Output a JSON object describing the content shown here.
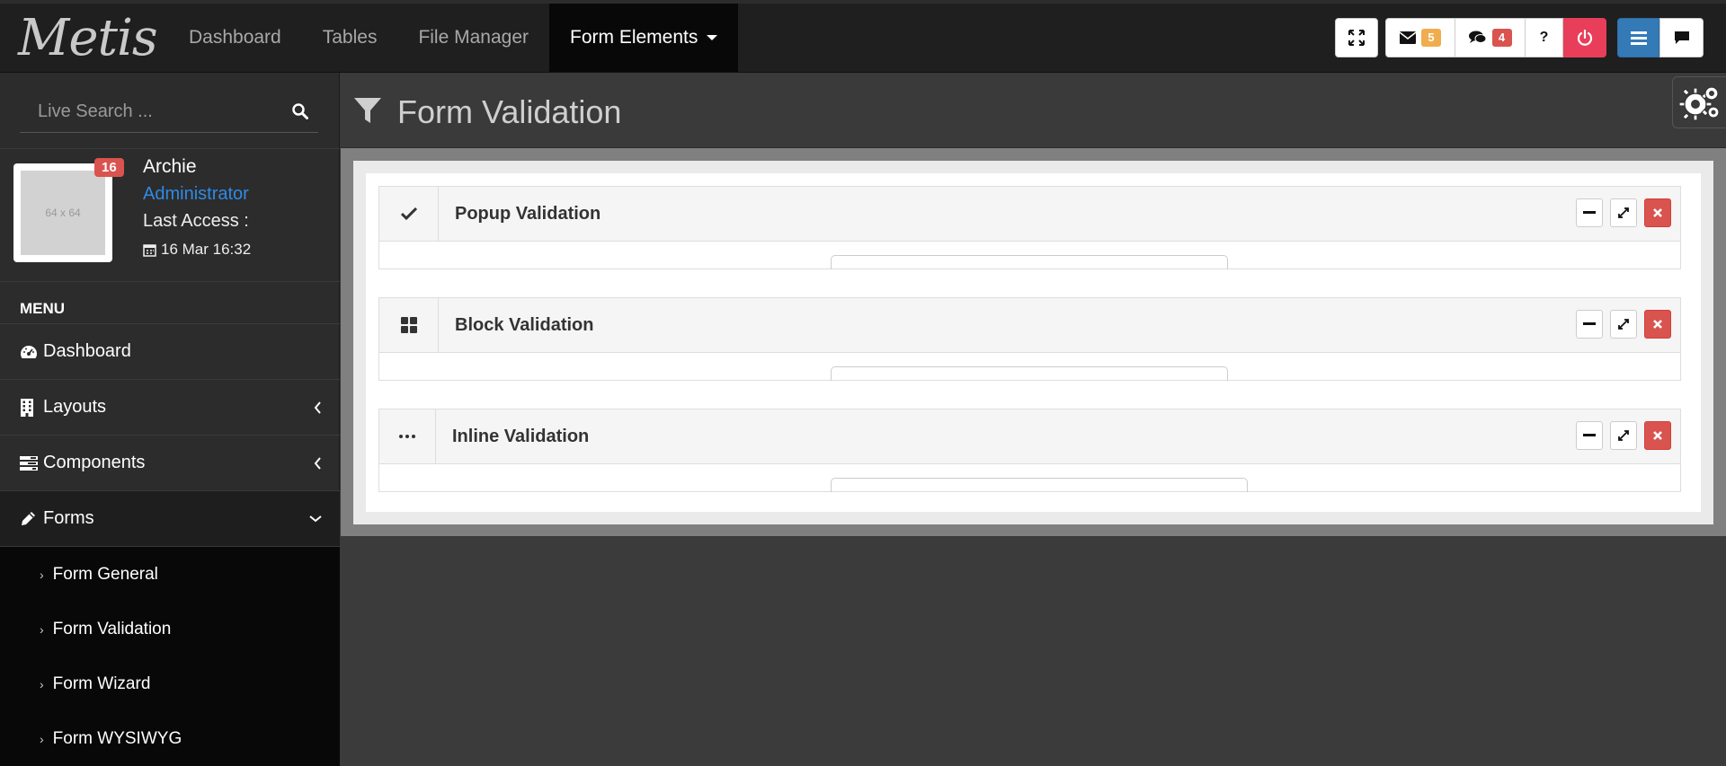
{
  "brand": {
    "logo_text": "Metis"
  },
  "topnav": {
    "items": [
      {
        "label": "Dashboard"
      },
      {
        "label": "Tables"
      },
      {
        "label": "File Manager"
      },
      {
        "label": "Form Elements",
        "active": true,
        "has_dropdown": true
      }
    ]
  },
  "toolbar": {
    "fullscreen_icon": "fullscreen-icon",
    "messages": {
      "icon": "envelope-icon",
      "count": "5"
    },
    "comments": {
      "icon": "comments-icon",
      "count": "4"
    },
    "help_label": "?",
    "power_icon": "power-icon",
    "menu_icon": "menu-icon",
    "chat_icon": "chat-icon"
  },
  "sidebar": {
    "search": {
      "placeholder": "Live Search ...",
      "value": ""
    },
    "user": {
      "avatar_placeholder": "64 x 64",
      "notification_count": "16",
      "name": "Archie",
      "role": "Administrator",
      "last_access_label": "Last Access :",
      "last_access_date": "16 Mar 16:32"
    },
    "menu_heading": "MENU",
    "items": [
      {
        "label": "Dashboard",
        "icon": "dashboard-icon",
        "expandable": false
      },
      {
        "label": "Layouts",
        "icon": "building-icon",
        "expandable": true,
        "open": false
      },
      {
        "label": "Components",
        "icon": "tasks-icon",
        "expandable": true,
        "open": false
      },
      {
        "label": "Forms",
        "icon": "pencil-icon",
        "expandable": true,
        "open": true
      }
    ],
    "submenu": [
      {
        "label": "Form General"
      },
      {
        "label": "Form Validation"
      },
      {
        "label": "Form Wizard"
      },
      {
        "label": "Form WYSIWYG"
      }
    ]
  },
  "page": {
    "title": "Form Validation",
    "icon": "filter-icon",
    "settings_icon": "gears-icon"
  },
  "boxes": [
    {
      "title": "Popup Validation",
      "icon": "check-icon"
    },
    {
      "title": "Block Validation",
      "icon": "th-large-icon"
    },
    {
      "title": "Inline Validation",
      "icon": "ellipsis-icon"
    }
  ],
  "colors": {
    "accent_blue": "#337ab7",
    "danger_red": "#d9534f",
    "power_red": "#e83e5a",
    "badge_orange": "#f0ad4e",
    "role_link": "#2f8ae6"
  }
}
